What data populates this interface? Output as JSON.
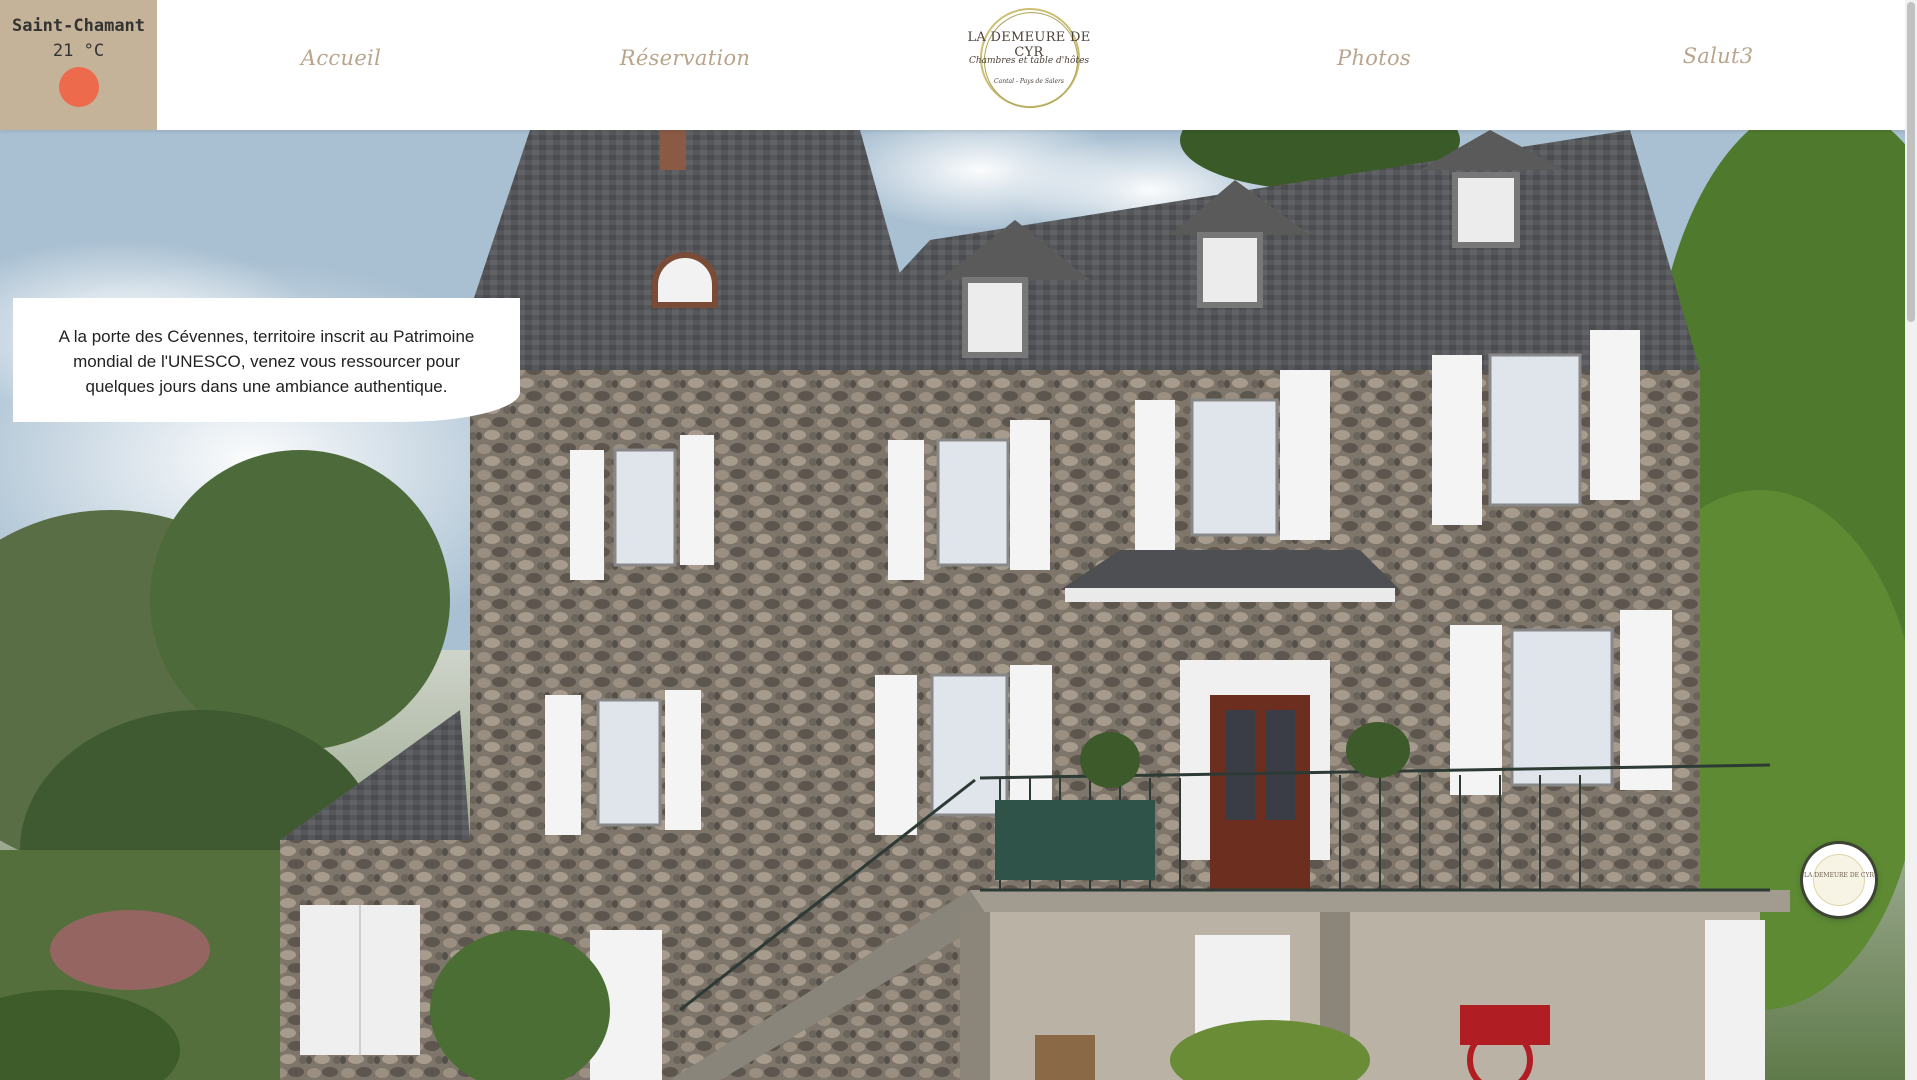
{
  "weather": {
    "city": "Saint-Chamant",
    "temperature": "21 °C",
    "icon": "sun-icon",
    "icon_color": "#ee6a4c",
    "background": "#c4b299"
  },
  "nav": {
    "items": [
      {
        "label": "Accueil"
      },
      {
        "label": "Réservation"
      },
      {
        "label": "Photos"
      },
      {
        "label": "Salut3"
      }
    ],
    "color": "#b9a48c"
  },
  "logo": {
    "title": "LA DEMEURE DE CYR",
    "subtitle": "Chambres et table d'hôtes",
    "place": "Cantal - Pays de Salers"
  },
  "hero": {
    "intro": "A la porte des Cévennes, territoire inscrit au Patrimoine mondial de l'UNESCO, venez vous ressourcer pour quelques jours dans une ambiance authentique."
  },
  "chat": {
    "label": "LA DEMEURE DE CYR"
  }
}
